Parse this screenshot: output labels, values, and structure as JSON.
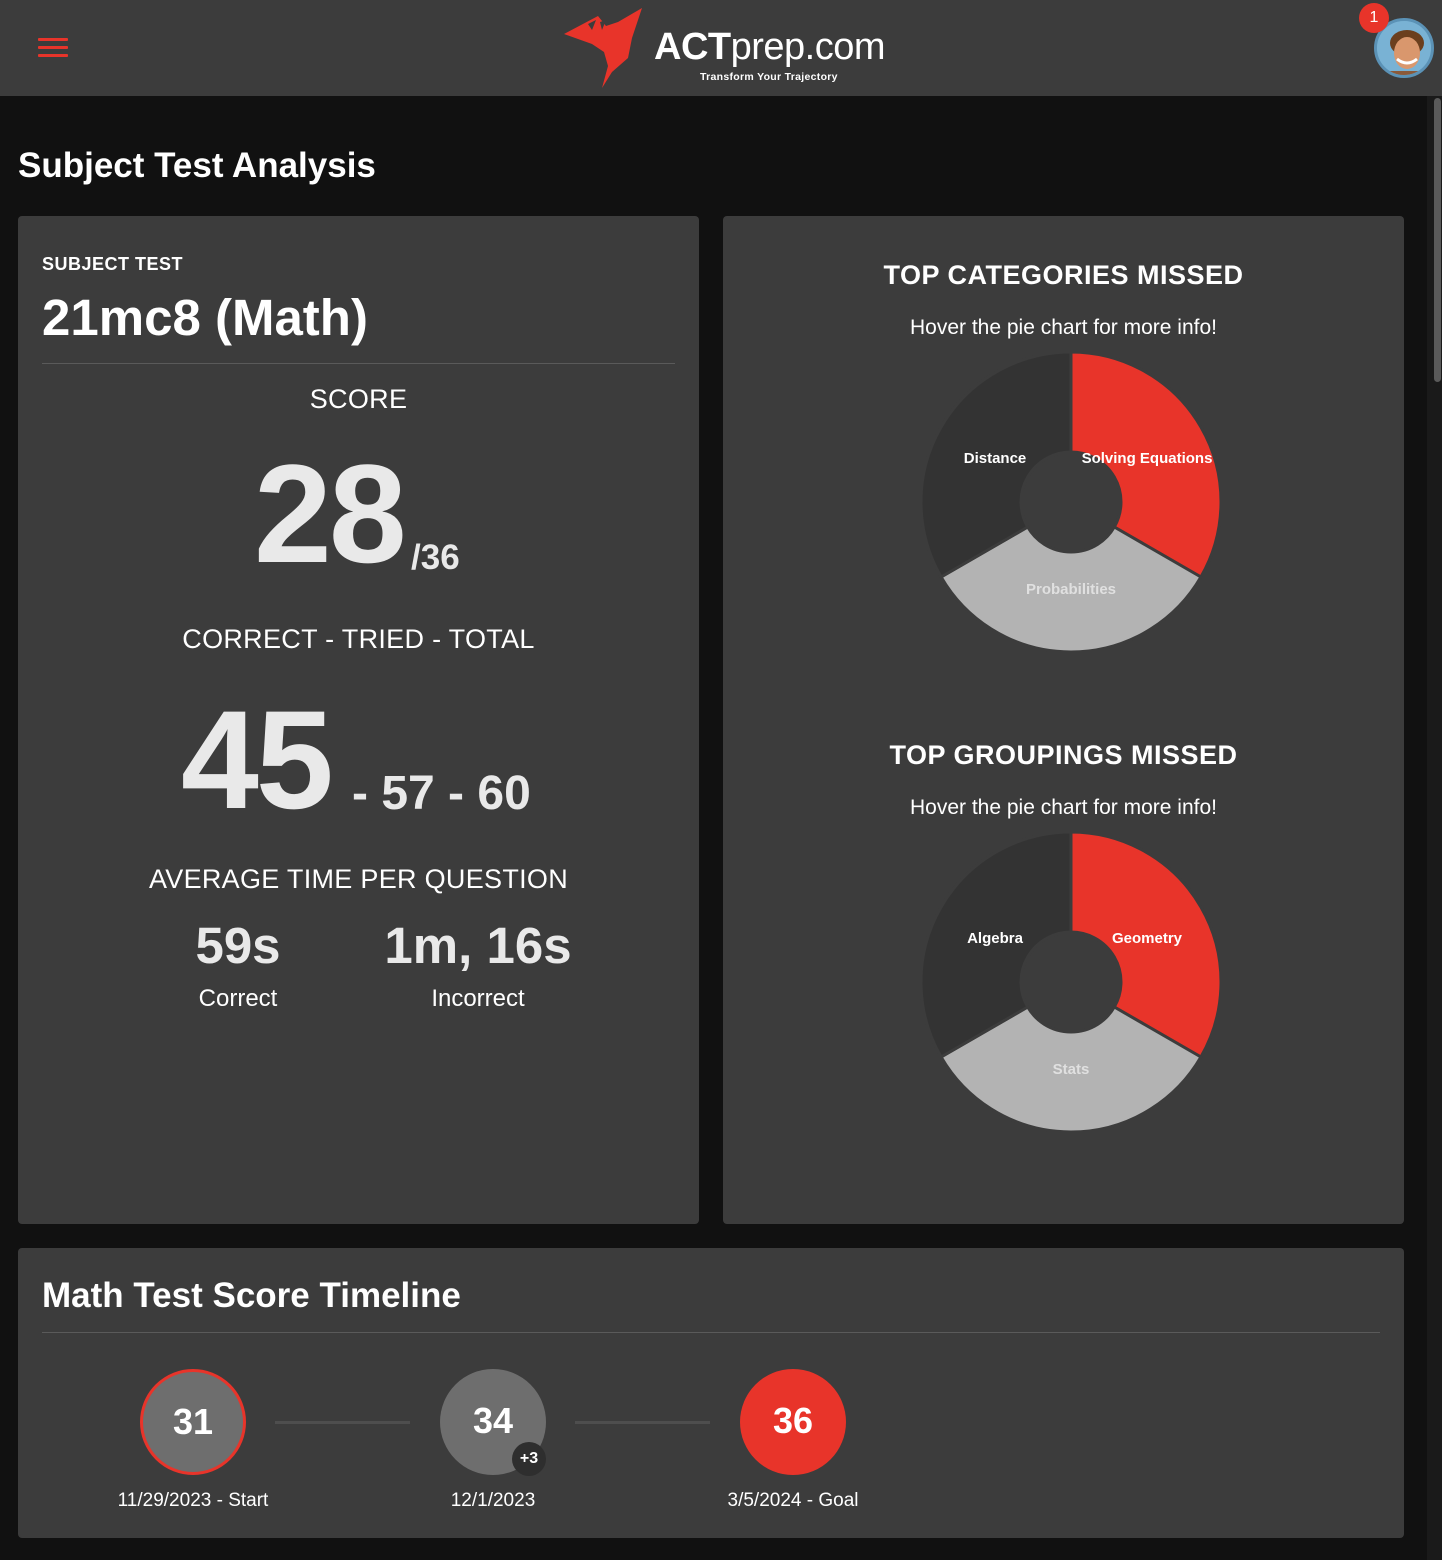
{
  "header": {
    "logo_act": "ACT",
    "logo_prep": "prep.com",
    "tagline": "Transform Your Trajectory",
    "notification_count": "1",
    "accent_color": "#e8342a"
  },
  "page": {
    "title": "Subject Test Analysis"
  },
  "summary": {
    "subject_label": "SUBJECT TEST",
    "test_name": "21mc8 (Math)",
    "score_label": "SCORE",
    "score": "28",
    "score_max": "/36",
    "ctt_label": "CORRECT - TRIED - TOTAL",
    "correct": "45",
    "tried_total": "- 57 - 60",
    "avg_time_label": "AVERAGE TIME PER QUESTION",
    "time_correct": "59s",
    "time_correct_label": "Correct",
    "time_incorrect": "1m, 16s",
    "time_incorrect_label": "Incorrect"
  },
  "categories": {
    "title": "TOP CATEGORIES MISSED",
    "hint": "Hover the pie chart for more info!",
    "slices": [
      "Solving Equations",
      "Probabilities",
      "Distance"
    ]
  },
  "groupings": {
    "title": "TOP GROUPINGS MISSED",
    "hint": "Hover the pie chart for more info!",
    "slices": [
      "Geometry",
      "Stats",
      "Algebra"
    ]
  },
  "timeline": {
    "title": "Math Test Score Timeline",
    "points": [
      {
        "score": "31",
        "date": "11/29/2023 - Start"
      },
      {
        "score": "34",
        "badge": "+3",
        "date": "12/1/2023"
      },
      {
        "score": "36",
        "date": "3/5/2024 - Goal"
      }
    ]
  },
  "chart_data": [
    {
      "type": "pie",
      "title": "TOP CATEGORIES MISSED",
      "categories": [
        "Solving Equations",
        "Probabilities",
        "Distance"
      ],
      "values": [
        1,
        1,
        1
      ],
      "colors": [
        "#e8342a",
        "#b3b3b3",
        "#333333"
      ]
    },
    {
      "type": "pie",
      "title": "TOP GROUPINGS MISSED",
      "categories": [
        "Geometry",
        "Stats",
        "Algebra"
      ],
      "values": [
        1,
        1,
        1
      ],
      "colors": [
        "#e8342a",
        "#b3b3b3",
        "#333333"
      ]
    }
  ]
}
